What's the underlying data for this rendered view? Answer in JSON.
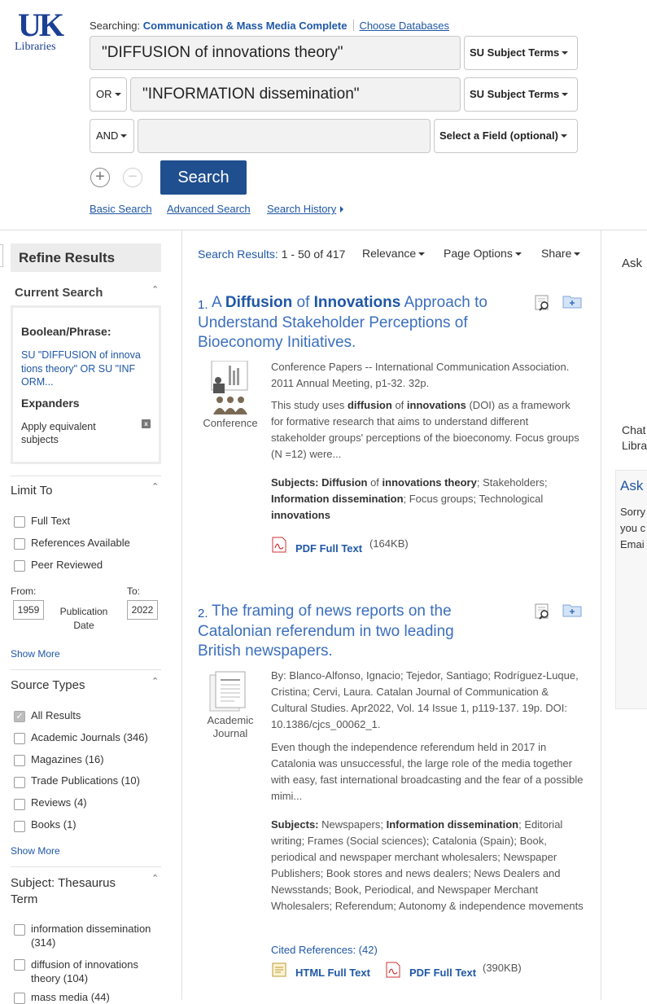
{
  "logo": {
    "mark": "UK",
    "text": "Libraries"
  },
  "header": {
    "searching_label": "Searching:",
    "database": "Communication & Mass Media Complete",
    "choose_databases": "Choose Databases"
  },
  "search": {
    "rows": [
      {
        "bool": "",
        "query": "\"DIFFUSION of innovations theory\"",
        "field": "SU Subject Terms"
      },
      {
        "bool": "OR",
        "query": "\"INFORMATION dissemination\"",
        "field": "SU Subject Terms"
      },
      {
        "bool": "AND",
        "query": "",
        "field": "Select a Field (optional)"
      }
    ],
    "add_symbol": "+",
    "remove_symbol": "−",
    "button": "Search",
    "links": {
      "basic": "Basic Search",
      "advanced": "Advanced Search",
      "history": "Search History"
    }
  },
  "refine": {
    "title": "Refine Results",
    "current_search": {
      "title": "Current Search",
      "boolean_label": "Boolean/Phrase:",
      "query_text": "SU \"DIFFUSION of innova tions theory\" OR SU \"INF ORM...",
      "expanders_label": "Expanders",
      "expander_item": "Apply equivalent subjects",
      "remove_symbol": "x"
    },
    "limit_to": {
      "title": "Limit To",
      "items": [
        "Full Text",
        "References Available",
        "Peer Reviewed"
      ],
      "from_label": "From:",
      "to_label": "To:",
      "from_value": "1959",
      "to_value": "2022",
      "date_label": "Publication Date",
      "show_more": "Show More"
    },
    "source_types": {
      "title": "Source Types",
      "items": [
        {
          "label": "All Results",
          "checked": true
        },
        {
          "label": "Academic Journals (346)",
          "checked": false
        },
        {
          "label": "Magazines (16)",
          "checked": false
        },
        {
          "label": "Trade Publications (10)",
          "checked": false
        },
        {
          "label": "Reviews (4)",
          "checked": false
        },
        {
          "label": "Books (1)",
          "checked": false
        }
      ],
      "show_more": "Show More"
    },
    "subject": {
      "title": "Subject: Thesaurus Term",
      "items": [
        {
          "label": "information dissemination",
          "count": "(314)"
        },
        {
          "label": "diffusion of innovations theory",
          "count": "(104)"
        },
        {
          "label": "mass media",
          "count": "(44)"
        }
      ]
    }
  },
  "results_bar": {
    "label": "Search Results:",
    "range": "1 - 50",
    "of": "of",
    "total": "417",
    "sort": "Relevance",
    "page_options": "Page Options",
    "share": "Share"
  },
  "results": [
    {
      "number": "1.",
      "title_parts": [
        "A ",
        "Diffusion",
        " of ",
        "Innovations",
        " Approach to Understand Stakeholder Perceptions of Bioeconomy Initiatives."
      ],
      "type_label": "Conference",
      "source": "Conference Papers -- International Communication Association. 2011 Annual Meeting, p1-32. 32p.",
      "abstract_parts": [
        "This study uses ",
        "diffusion",
        " of ",
        "innovations",
        " (DOI) as a framework for formative research that aims to understand different stakeholder groups' perceptions of the bioeconomy. Focus groups (N =12) were..."
      ],
      "subjects_label": "Subjects:",
      "subjects_parts": [
        " ",
        "Diffusion",
        " of ",
        "innovations theory",
        "; Stakeholders; ",
        "Information dissemination",
        "; Focus groups; Technological ",
        "innovations"
      ],
      "pdf_label": "PDF Full Text",
      "pdf_size": "(164KB)"
    },
    {
      "number": "2.",
      "title": "The framing of news reports on the Catalonian referendum in two leading British newspapers.",
      "type_label": "Academic Journal",
      "source": "By: Blanco-Alfonso, Ignacio; Tejedor, Santiago; Rodríguez-Luque, Cristina; Cervi, Laura. Catalan Journal of Communication & Cultural Studies. Apr2022, Vol. 14 Issue 1, p119-137. 19p. DOI: 10.1386/cjcs_00062_1.",
      "abstract": "Even though the independence referendum held in 2017 in Catalonia was unsuccessful, the large role of the media together with easy, fast international broadcasting and the fear of a possible mimi...",
      "subjects_label": "Subjects:",
      "subjects_parts": [
        " Newspapers; ",
        "Information dissemination",
        "; Editorial writing; Frames (Social sciences); Catalonia (Spain); Book, periodical and newspaper merchant wholesalers; Newspaper Publishers; Book stores and news dealers; News Dealers and Newsstands; Book, Periodical, and Newspaper Merchant Wholesalers; Referendum; Autonomy & independence movements"
      ],
      "cited": "Cited References: (42)",
      "html_label": "HTML Full Text",
      "pdf_label": "PDF Full Text",
      "pdf_size": "(390KB)"
    }
  ],
  "right_panel": {
    "ask": "Ask",
    "chat_line1": "Chat",
    "chat_line2": "Libra",
    "ask_title": "Ask",
    "sorry_line1": "Sorry",
    "sorry_line2": "you c",
    "sorry_line3": "Emai"
  },
  "colors": {
    "brand_blue": "#1f57a6",
    "search_button": "#1f4f8f",
    "link_blue": "#3b6fbd"
  }
}
